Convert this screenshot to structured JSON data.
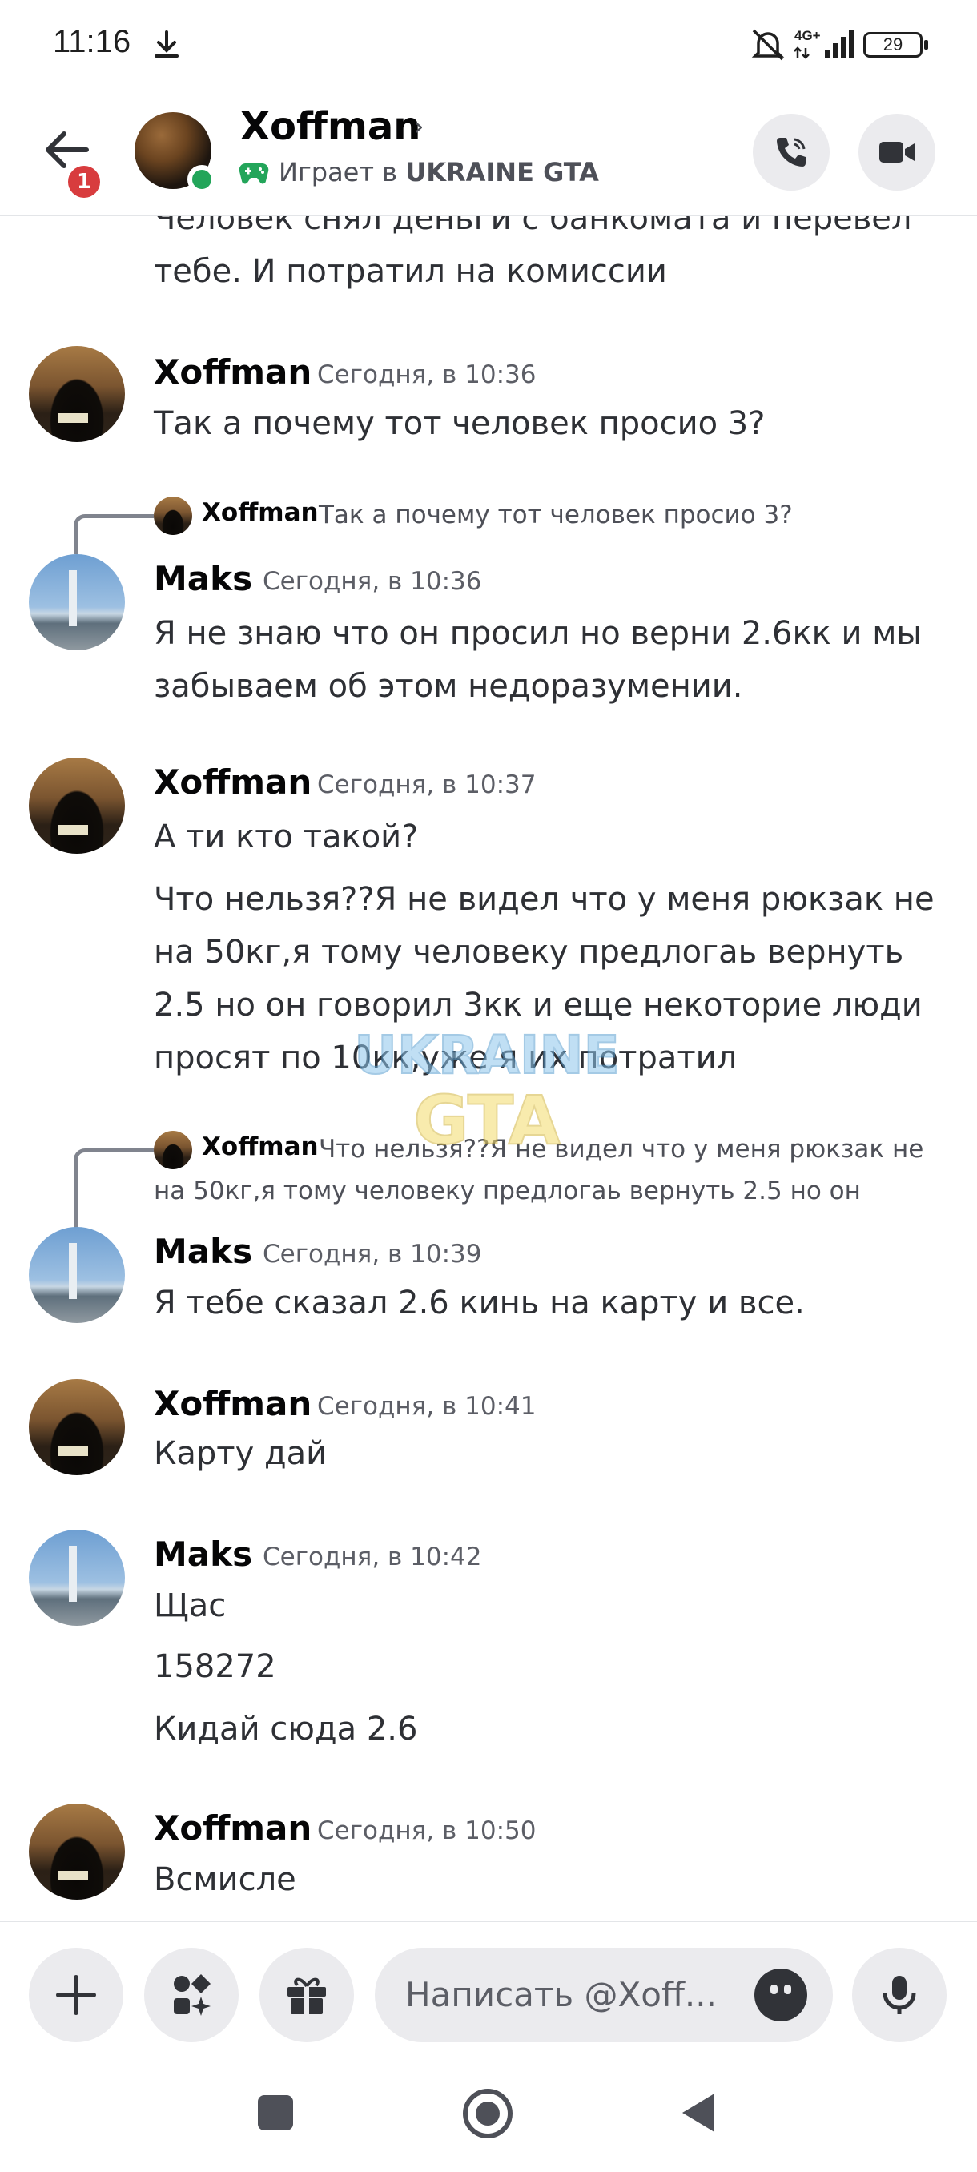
{
  "status_bar": {
    "time": "11:16",
    "network": "4G+",
    "battery": "29"
  },
  "header": {
    "name": "Xoffman",
    "chevron": "›",
    "badge": "1",
    "activity_prefix": "Играет в ",
    "activity_game": "UKRAINE GTA"
  },
  "messages": [
    {
      "id": "m0",
      "text_line1": "Человек снял деньги с банкомата и перевел",
      "text_line2": "тебе. И потратил на комиссии"
    },
    {
      "id": "m1",
      "author": "Xoffman",
      "time": "Сегодня, в 10:36",
      "lines": [
        "Так а почему тот человек просио 3?"
      ]
    },
    {
      "id": "m2",
      "reply_author": "Xoffman",
      "reply_text": "Так а почему тот человек просио 3?",
      "author": "Maks",
      "time": "Сегодня, в 10:36",
      "lines": [
        "Я не знаю что он просил но верни 2.6кк и мы",
        "забываем об этом недоразумении."
      ]
    },
    {
      "id": "m3",
      "author": "Xoffman",
      "time": "Сегодня, в 10:37",
      "lines": [
        "А ти кто такой?",
        "Что нельзя??Я не видел что у меня рюкзак не",
        "на 50кг,я тому человеку предлогаь вернуть",
        "2.5 но он говорил 3кк и еще некоторие люди",
        "просят по 10кк,уже я их потратил"
      ]
    },
    {
      "id": "m4",
      "reply_author": "Xoffman",
      "reply_text_line1": "Что нельзя??Я не видел что у меня рюкзак не",
      "reply_text_line2": "на 50кг,я тому человеку предлогаь вернуть 2.5 но он",
      "author": "Maks",
      "time": "Сегодня, в 10:39",
      "lines": [
        "Я тебе сказал 2.6 кинь на карту и все."
      ]
    },
    {
      "id": "m5",
      "author": "Xoffman",
      "time": "Сегодня, в 10:41",
      "lines": [
        "Карту дай"
      ]
    },
    {
      "id": "m6",
      "author": "Maks",
      "time": "Сегодня, в 10:42",
      "lines": [
        "Щас",
        "158272",
        "Кидай сюда 2.6"
      ]
    },
    {
      "id": "m7",
      "author": "Xoffman",
      "time": "Сегодня, в 10:50",
      "lines": [
        "Всмисле"
      ]
    }
  ],
  "watermark": {
    "line1": "UKRAINE",
    "line2": "GTA"
  },
  "composer": {
    "placeholder": "Написать @Xoff..."
  },
  "colors": {
    "online": "#23a55a",
    "badge": "#d83c3e",
    "game_icon": "#23a55a"
  }
}
